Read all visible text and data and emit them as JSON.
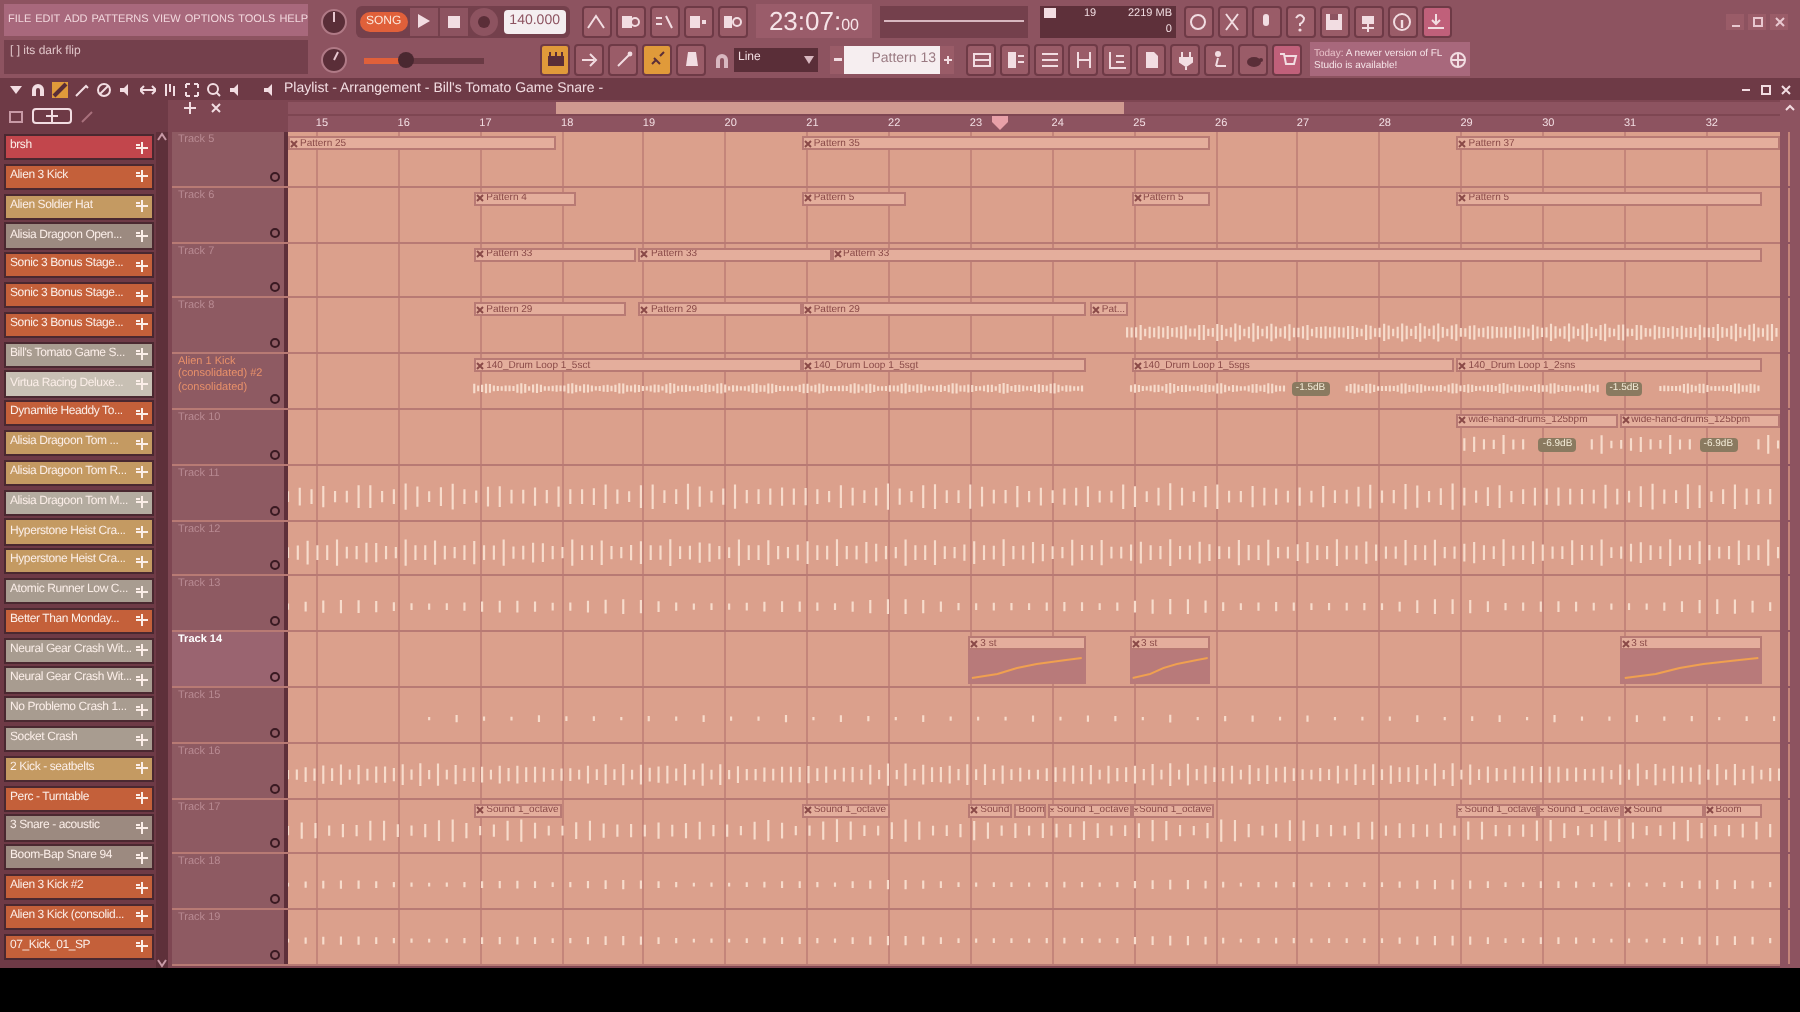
{
  "menu": [
    "FILE",
    "EDIT",
    "ADD",
    "PATTERNS",
    "VIEW",
    "OPTIONS",
    "TOOLS",
    "HELP"
  ],
  "hint": "[  ] its dark flip",
  "transport": {
    "mode": "SONG",
    "tempo": "140.000",
    "time": "23:07:",
    "time_cs": "00"
  },
  "volume": {
    "level": 0.35
  },
  "cpu": {
    "value": "19",
    "memory": "2219 MB",
    "polyphony": "0"
  },
  "snap": "Line",
  "pattern": "Pattern 13",
  "news": {
    "date": "Today:",
    "text": "A newer version of FL Studio is available!"
  },
  "playlist_title": "Playlist - Arrangement - Bill's Tomato Game Snare -",
  "ruler": [
    "15",
    "16",
    "17",
    "18",
    "19",
    "20",
    "21",
    "22",
    "23",
    "24",
    "25",
    "26",
    "27",
    "28",
    "29",
    "30",
    "31",
    "32"
  ],
  "channels": [
    {
      "name": "brsh",
      "color": "#c2464c"
    },
    {
      "name": "Alien 3 Kick",
      "color": "#c4603a"
    },
    {
      "name": "Alien Soldier Hat",
      "color": "#c49a62"
    },
    {
      "name": "Alisia Dragoon Open...",
      "color": "#9c8a80"
    },
    {
      "name": "Sonic 3 Bonus Stage...",
      "color": "#c4603a"
    },
    {
      "name": "Sonic 3 Bonus Stage...",
      "color": "#c4603a"
    },
    {
      "name": "Sonic 3 Bonus Stage...",
      "color": "#c4603a"
    },
    {
      "name": "Bill's Tomato Game S...",
      "color": "#a89c90"
    },
    {
      "name": "Virtua Racing Deluxe...",
      "color": "#c8c0b4"
    },
    {
      "name": "Dynamite Headdy To...",
      "color": "#c4603a"
    },
    {
      "name": "Alisia Dragoon Tom ...",
      "color": "#c49a62"
    },
    {
      "name": "Alisia Dragoon Tom R...",
      "color": "#c49a62"
    },
    {
      "name": "Alisia Dragoon Tom M...",
      "color": "#b4aca0"
    },
    {
      "name": "Hyperstone Heist Cra...",
      "color": "#c49a62"
    },
    {
      "name": "Hyperstone Heist Cra...",
      "color": "#c49a62"
    },
    {
      "name": "Atomic Runner Low C...",
      "color": "#a89c90"
    },
    {
      "name": "Better Than Monday...",
      "color": "#c4603a"
    },
    {
      "name": "Neural Gear Crash Wit...",
      "color": "#a89c90"
    },
    {
      "name": "Neural Gear Crash Wit...",
      "color": "#a89c90"
    },
    {
      "name": "No Problemo Crash 1...",
      "color": "#a89c90"
    },
    {
      "name": "Socket Crash",
      "color": "#a89c90"
    },
    {
      "name": "2 Kick - seatbelts",
      "color": "#c49a62"
    },
    {
      "name": "Perc - Turntable",
      "color": "#c4603a"
    },
    {
      "name": "3 Snare - acoustic",
      "color": "#9c8a80"
    },
    {
      "name": "Boom-Bap Snare 94",
      "color": "#9c8a80"
    },
    {
      "name": "Alien 3 Kick #2",
      "color": "#c4603a"
    },
    {
      "name": "Alien 3 Kick (consolid...",
      "color": "#c4603a"
    },
    {
      "name": "07_Kick_01_SP",
      "color": "#c4603a"
    }
  ],
  "tracks": [
    {
      "label": "Track 5",
      "selected": false,
      "clips": [
        {
          "label": "Pattern 25"
        },
        {
          "label": "Pattern 35"
        },
        {
          "label": "Pattern 37"
        }
      ]
    },
    {
      "label": "Track 6",
      "selected": false,
      "clips": [
        {
          "label": "Pattern 4"
        },
        {
          "label": "Pattern 5"
        },
        {
          "label": "Pattern 5"
        },
        {
          "label": "Pattern 5"
        }
      ]
    },
    {
      "label": "Track 7",
      "selected": false,
      "clips": [
        {
          "label": "Pattern 33"
        },
        {
          "label": "Pattern 33"
        },
        {
          "label": "Pattern 33"
        }
      ]
    },
    {
      "label": "Track 8",
      "selected": false,
      "clips": [
        {
          "label": "Pattern 29"
        },
        {
          "label": "Pattern 29"
        },
        {
          "label": "Pattern 29"
        },
        {
          "label": "Pat..."
        }
      ]
    },
    {
      "label": "Alien 1 Kick (consolidated) #2 (consolidated)",
      "selected": false,
      "clips": [
        {
          "label": "140_Drum Loop 1_5sct"
        },
        {
          "label": "140_Drum Loop 1_5sgt"
        },
        {
          "label": "140_Drum Loop 1_5sgs"
        },
        {
          "label": "140_Drum Loop 1_2sns"
        }
      ],
      "badges": [
        "-1.5dB",
        "-1.5dB"
      ]
    },
    {
      "label": "Track 10",
      "selected": false,
      "clips": [
        {
          "label": "wide-hand-drums_125bpm"
        },
        {
          "label": "wide-hand-drums_125bpm"
        }
      ],
      "badges": [
        "-6.9dB",
        "-6.9dB"
      ]
    },
    {
      "label": "Track 11",
      "selected": false
    },
    {
      "label": "Track 12",
      "selected": false
    },
    {
      "label": "Track 13",
      "selected": false
    },
    {
      "label": "Track 14",
      "selected": true,
      "clips": [
        {
          "label": "3 st"
        },
        {
          "label": "3 st"
        },
        {
          "label": "3 st"
        }
      ]
    },
    {
      "label": "Track 15",
      "selected": false
    },
    {
      "label": "Track 16",
      "selected": false
    },
    {
      "label": "Track 17",
      "selected": false,
      "clips": [
        {
          "label": "Sound 1_octave"
        },
        {
          "label": "Sound 1_octave"
        },
        {
          "label": "Sound"
        },
        {
          "label": "Boom"
        },
        {
          "label": "Sound 1_octave"
        },
        {
          "label": "Sound 1_octave"
        },
        {
          "label": "Sound 1_octave"
        },
        {
          "label": "Sound 1_octave"
        },
        {
          "label": "Sound"
        },
        {
          "label": "Boom"
        }
      ]
    },
    {
      "label": "Track 18",
      "selected": false
    },
    {
      "label": "Track 19",
      "selected": false
    }
  ]
}
